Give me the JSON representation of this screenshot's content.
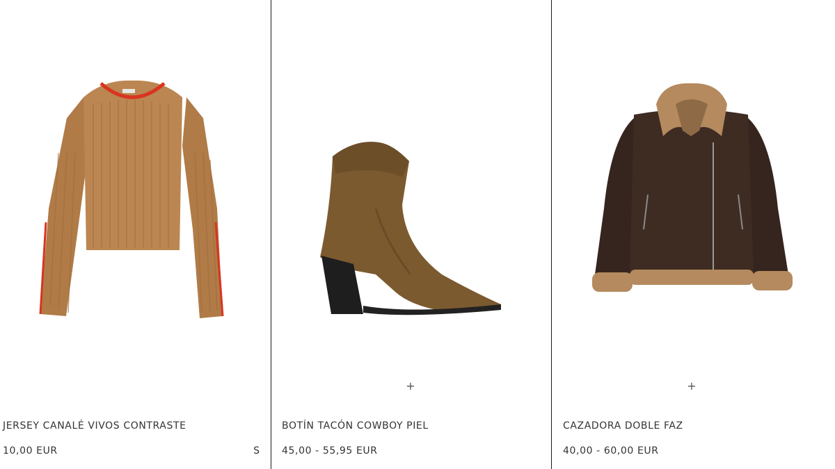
{
  "products": [
    {
      "name": "JERSEY CANALÉ VIVOS CONTRASTE",
      "price": "10,00 EUR",
      "size": "S",
      "image": "ribbed-sweater-image",
      "colors": {
        "body": "#b9844f",
        "trim": "#d9341f"
      }
    },
    {
      "name": "BOTÍN TACÓN COWBOY PIEL",
      "price": "45,00 - 55,95 EUR",
      "add_icon": "+",
      "image": "cowboy-boot-image",
      "colors": {
        "suede": "#7b5a2f",
        "heel": "#1e1e1e"
      }
    },
    {
      "name": "CAZADORA DOBLE FAZ",
      "price": "40,00 - 60,00 EUR",
      "add_icon": "+",
      "image": "shearling-jacket-image",
      "colors": {
        "leather": "#3b2a22",
        "fleece": "#b48a5e"
      }
    }
  ]
}
